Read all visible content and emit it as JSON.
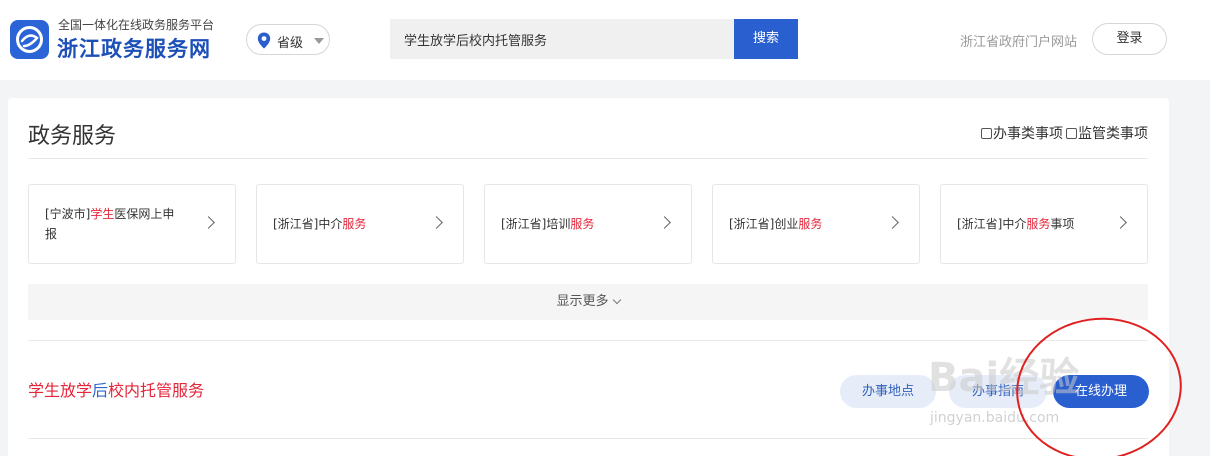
{
  "header": {
    "platform_subtitle": "全国一体化在线政务服务平台",
    "site_name": "浙江政务服务网",
    "region_label": "省级",
    "search_value": "学生放学后校内托管服务",
    "search_button": "搜索",
    "portal_link": "浙江省政府门户网站",
    "login_button": "登录"
  },
  "section": {
    "title": "政务服务",
    "filter_1": "办事类事项",
    "filter_2": "监管类事项"
  },
  "tiles": [
    {
      "pre": "[宁波市]",
      "hl": "学生",
      "post": "医保网上申报"
    },
    {
      "pre": "[浙江省]中介",
      "hl": "服务",
      "post": ""
    },
    {
      "pre": "[浙江省]培训",
      "hl": "服务",
      "post": ""
    },
    {
      "pre": "[浙江省]创业",
      "hl": "服务",
      "post": ""
    },
    {
      "pre": "[浙江省]中介",
      "hl": "服务",
      "post": "事项"
    }
  ],
  "show_more": "显示更多",
  "result": {
    "title_part1": "学生放学",
    "title_part2": "后",
    "title_part3": "校内托管服务",
    "btn_location": "办事地点",
    "btn_guide": "办事指南",
    "btn_online": "在线办理"
  },
  "watermark": {
    "text": "Bai经验",
    "url": "jingyan.baidu.com"
  },
  "colors": {
    "brand_blue": "#2a5fd0",
    "highlight_red": "#e5253a",
    "annotation_red": "#e02020"
  }
}
